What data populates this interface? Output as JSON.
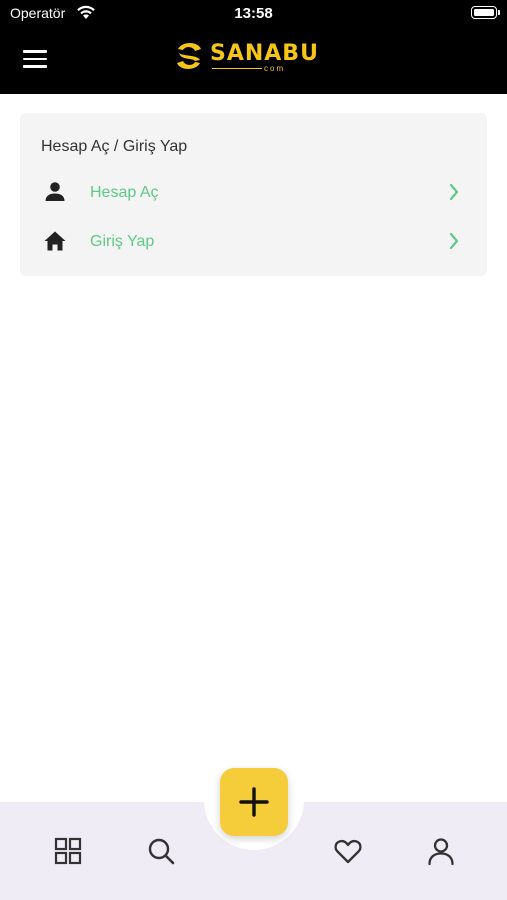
{
  "status_bar": {
    "carrier": "Operatör",
    "time": "13:58"
  },
  "header": {
    "logo_text": "SANABU",
    "logo_sub": "com",
    "brand_color": "#f5c518"
  },
  "card": {
    "title": "Hesap Aç / Giriş Yap",
    "items": [
      {
        "label": "Hesap Aç",
        "icon": "user-icon"
      },
      {
        "label": "Giriş Yap",
        "icon": "home-icon"
      }
    ],
    "link_color": "#5fc98a"
  },
  "bottom_nav": {
    "items": [
      "grid-icon",
      "search-icon",
      "plus-icon",
      "heart-icon",
      "user-icon"
    ],
    "fab_color": "#f5cc3a"
  }
}
